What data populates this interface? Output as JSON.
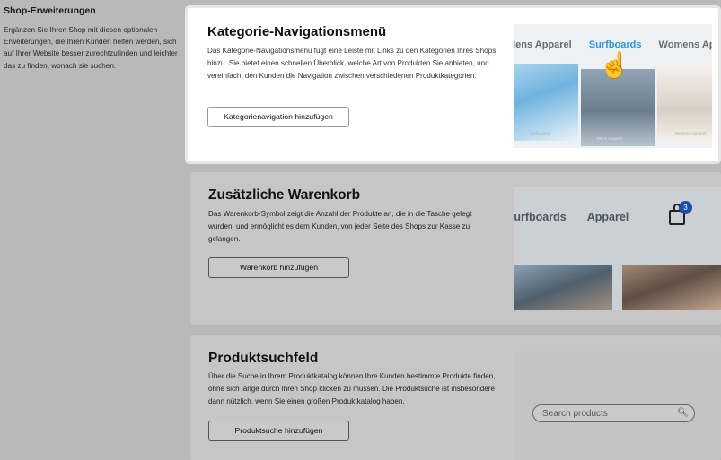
{
  "sidebar": {
    "title": "Shop-Erweiterungen",
    "description": "Ergänzen Sie Ihren Shop mit diesen optionalen Erweiterungen, die Ihren Kunden helfen werden, sich auf Ihrer Website besser zurechtzufinden und leichter das zu finden, wonach sie suchen."
  },
  "cards": [
    {
      "title": "Kategorie-Navigationsmenü",
      "description": "Das Kategorie-Navigationsmenü fügt eine Leiste mit Links zu den Kategorien Ihres Shops hinzu. Sie bietet einen schnellen Überblick, welche Art von Produkten Sie anbieten, und vereinfacht den Kunden die Navigation zwischen verschiedenen Produktkategorien.",
      "button": "Kategorienavigation hinzufügen",
      "preview": {
        "nav": [
          "Mens Apparel",
          "Surfboards",
          "Womens Apparel"
        ],
        "captions": [
          "Surfboards",
          "Mens Apparel",
          "Womens Apparel"
        ],
        "highlight_color": "#2f95d5",
        "icon": "hand-pointer-icon"
      }
    },
    {
      "title": "Zusätzliche Warenkorb",
      "description": "Das Warenkorb-Symbol zeigt die Anzahl der Produkte an, die in die Tasche gelegt wurden, und ermöglicht es dem Kunden, von jeder Seite des Shops zur Kasse zu gelangen.",
      "button": "Warenkorb hinzufügen",
      "preview": {
        "nav": [
          "Surfboards",
          "Apparel"
        ],
        "cart_count": "3",
        "badge_color": "#1a4fae",
        "icon": "shopping-bag-icon"
      }
    },
    {
      "title": "Produktsuchfeld",
      "description": "Über die Suche in Ihrem Produktkatalog können Ihre Kunden bestimmte Produkte finden, ohne sich lange durch Ihren Shop klicken zu müssen. Die Produktsuche ist insbesondere dann nützlich, wenn Sie einen großen Produktkatalog haben.",
      "button": "Produktsuche hinzufügen",
      "preview": {
        "search_placeholder": "Search products",
        "icon": "search-icon"
      }
    }
  ]
}
